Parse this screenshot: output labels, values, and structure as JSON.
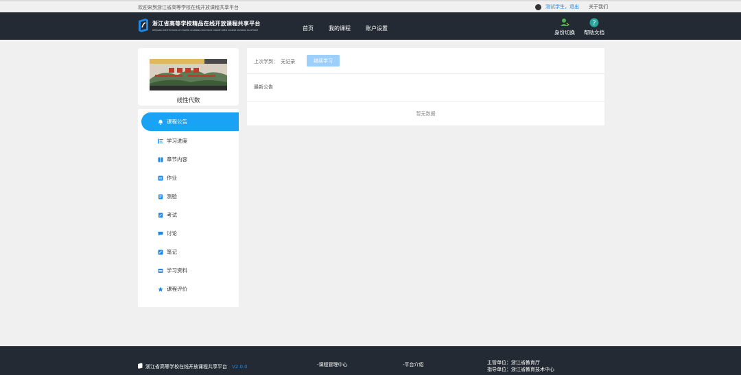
{
  "topbar": {
    "welcome": "欢迎来到浙江省高等学校在线开放课程共享平台",
    "user_link": "测试学生，退出",
    "about": "关于我们"
  },
  "header": {
    "logo_cn": "浙江省高等学校精品在线开放课程共享平台",
    "logo_en": "ZHEJIANG INSTITUTIONS OF HIGHER LEARNING BOUTIQUE ONLINE OPEN COURSE SHARING PLATFORM",
    "nav": [
      "首页",
      "我的课程",
      "账户设置"
    ],
    "tools": [
      {
        "label": "身份切换",
        "icon": "user-switch-icon"
      },
      {
        "label": "帮助文档",
        "icon": "help-icon"
      }
    ]
  },
  "course": {
    "name": "线性代数"
  },
  "menu": [
    {
      "label": "课程公告",
      "icon": "bell-icon",
      "active": true
    },
    {
      "label": "学习进度",
      "icon": "progress-list-icon"
    },
    {
      "label": "章节内容",
      "icon": "book-icon"
    },
    {
      "label": "作业",
      "icon": "homework-icon"
    },
    {
      "label": "测验",
      "icon": "quiz-icon"
    },
    {
      "label": "考试",
      "icon": "exam-icon"
    },
    {
      "label": "讨论",
      "icon": "discussion-icon"
    },
    {
      "label": "笔记",
      "icon": "notes-icon"
    },
    {
      "label": "学习资料",
      "icon": "materials-icon"
    },
    {
      "label": "课程评价",
      "icon": "star-icon"
    }
  ],
  "main": {
    "last_study_label": "上次学到：",
    "last_study_value": "无记录",
    "continue_button": "继续学习",
    "latest_announcements": "最新公告",
    "empty_text": "暂无数据"
  },
  "footer": {
    "platform": "浙江省高等学校在线开放课程共享平台",
    "version": "V2.0.0",
    "link1": "-课程管理中心",
    "link2": "-平台介绍",
    "sponsor": "主管单位：浙江省教育厅",
    "guide": "指导单位：浙江省教育技术中心"
  },
  "colors": {
    "header_bg": "#232a33",
    "accent": "#1aa3f5",
    "button_disabled": "#9ccffa"
  }
}
